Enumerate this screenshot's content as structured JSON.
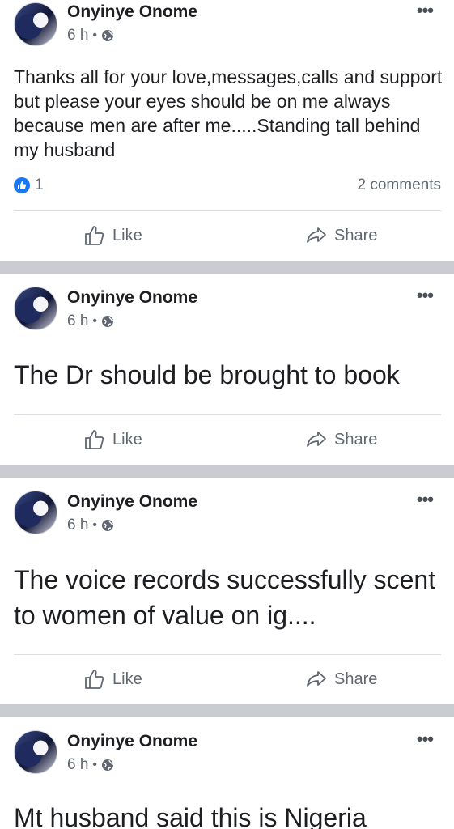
{
  "posts": [
    {
      "author": "Onyinye Onome",
      "time": "6 h",
      "text": "Thanks all for your love,messages,calls and support but please your eyes should be on me always because men are after me.....Standing tall behind my husband",
      "reaction_count": "1",
      "comments": "2 comments",
      "like_label": "Like",
      "share_label": "Share"
    },
    {
      "author": "Onyinye Onome",
      "time": "6 h",
      "text": "The Dr should be brought to book",
      "like_label": "Like",
      "share_label": "Share"
    },
    {
      "author": "Onyinye Onome",
      "time": "6 h",
      "text": "The voice records successfully scent to women of value on ig....",
      "like_label": "Like",
      "share_label": "Share"
    },
    {
      "author": "Onyinye Onome",
      "time": "6 h",
      "text": "Mt husband said this is Nigeria"
    }
  ],
  "icons": {
    "more": "more-options-icon",
    "globe": "globe-icon",
    "like": "thumbs-up-icon",
    "share": "share-arrow-icon"
  },
  "colors": {
    "accent": "#1877f2",
    "separator": "#c9ccd1",
    "secondary_text": "#606770"
  }
}
